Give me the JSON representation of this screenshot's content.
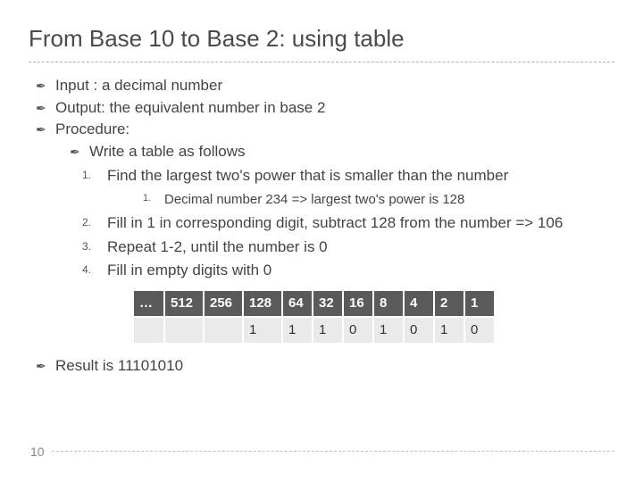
{
  "title": "From Base 10 to Base 2: using table",
  "bullets": {
    "b0": "Input : a decimal number",
    "b1": "Output: the equivalent number in base 2",
    "b2": "Procedure:",
    "b2sub": "Write a table as follows"
  },
  "steps": {
    "s1": "Find the largest two's power that is smaller than the number",
    "s1a": "Decimal number 234 => largest two's power is 128",
    "s2": "Fill in 1 in corresponding digit, subtract 128 from the number => 106",
    "s3": "Repeat 1-2, until the number is 0",
    "s4": "Fill in empty digits with 0"
  },
  "nums": {
    "n1": "1.",
    "n2": "2.",
    "n3": "3.",
    "n4": "4.",
    "sn1": "1."
  },
  "table": {
    "headers": [
      "…",
      "512",
      "256",
      "128",
      "64",
      "32",
      "16",
      "8",
      "4",
      "2",
      "1"
    ],
    "row": [
      "",
      "",
      "",
      "1",
      "1",
      "1",
      "0",
      "1",
      "0",
      "1",
      "0"
    ]
  },
  "result": "Result is 11101010",
  "page": "10",
  "glyph": "✒"
}
